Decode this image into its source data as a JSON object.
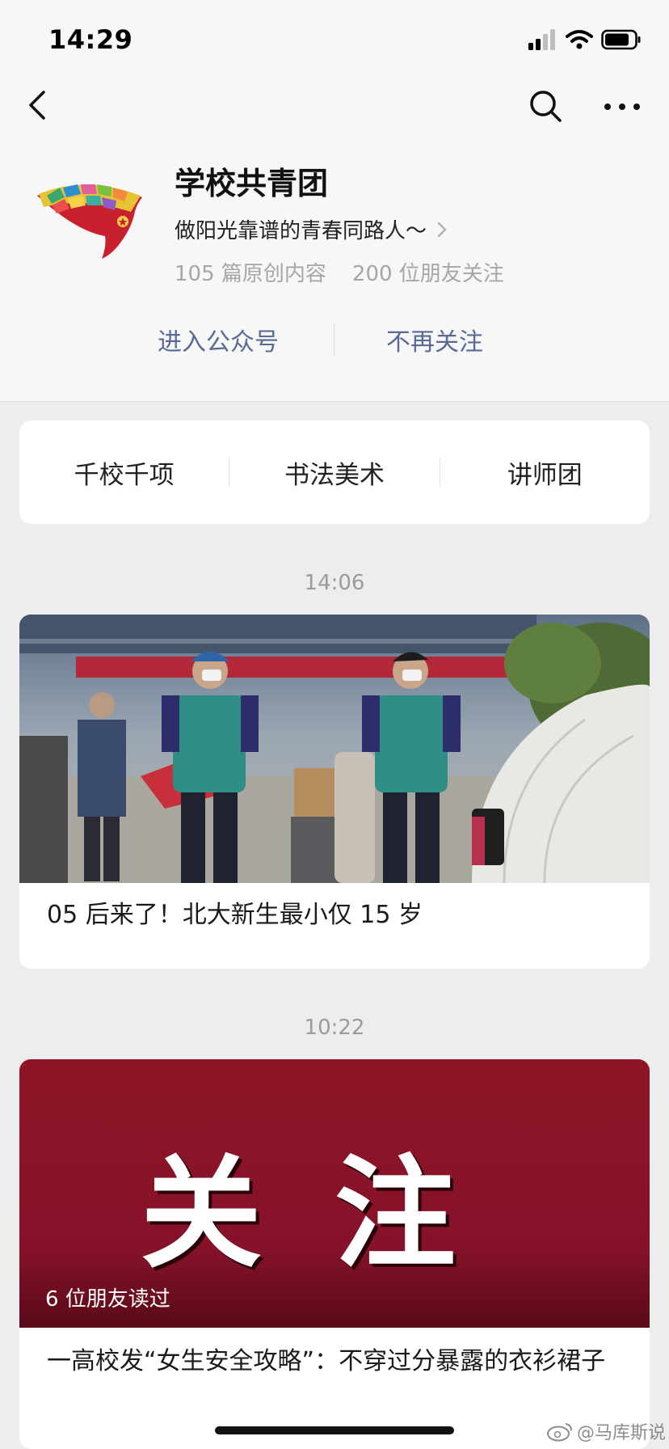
{
  "status_bar": {
    "time": "14:29"
  },
  "profile": {
    "name": "学校共青团",
    "description": "做阳光靠谱的青春同路人～",
    "stats": [
      "105 篇原创内容",
      "200 位朋友关注"
    ],
    "actions": {
      "enter": "进入公众号",
      "unfollow": "不再关注"
    }
  },
  "menu": {
    "items": [
      "千校千项",
      "书法美术",
      "讲师团"
    ]
  },
  "articles": [
    {
      "time": "14:06",
      "title": "05 后来了！北大新生最小仅 15 岁"
    },
    {
      "time": "10:22",
      "banner_text": "关注",
      "read_count": "6 位朋友读过",
      "title": "一高校发“女生安全攻略”：不穿过分暴露的衣衫裙子"
    }
  ],
  "watermark": "@马库斯说",
  "colors": {
    "link": "#576b95",
    "banner": "#86122a",
    "background": "#ededed"
  }
}
